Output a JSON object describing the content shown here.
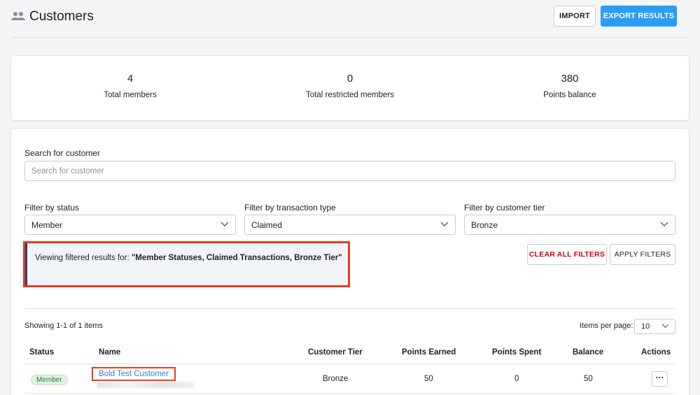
{
  "header": {
    "title": "Customers",
    "icon": "people-icon",
    "import_label": "IMPORT",
    "export_label": "EXPORT RESULTS",
    "accent": "#2d9cf4"
  },
  "stats": [
    {
      "value": "4",
      "label": "Total members"
    },
    {
      "value": "0",
      "label": "Total restricted members"
    },
    {
      "value": "380",
      "label": "Points balance"
    }
  ],
  "search": {
    "label": "Search for customer",
    "placeholder": "Search for customer",
    "value": ""
  },
  "filters": {
    "status": {
      "label": "Filter by status",
      "selected": "Member"
    },
    "transaction": {
      "label": "Filter by transaction type",
      "selected": "Claimed"
    },
    "tier": {
      "label": "Filter by customer tier",
      "selected": "Bronze"
    },
    "clear_label": "CLEAR ALL FILTERS",
    "apply_label": "APPLY FILTERS"
  },
  "banner": {
    "prefix": "Viewing filtered results for: ",
    "value": "\"Member Statuses, Claimed Transactions, Bronze Tier\""
  },
  "results": {
    "showing": "Showing 1-1 of 1 items",
    "items_per_page_label": "Items per page:",
    "items_per_page": "10"
  },
  "table": {
    "columns": [
      "Status",
      "Name",
      "Customer Tier",
      "Points Earned",
      "Points Spent",
      "Balance",
      "Actions"
    ],
    "rows": [
      {
        "status": "Member",
        "name": "Bold Test Customer",
        "tier": "Bronze",
        "earned": "50",
        "spent": "0",
        "balance": "50",
        "actions": "···"
      }
    ]
  },
  "colors": {
    "highlight": "#ec3a1f",
    "link": "#2d7fd4",
    "badge_bg": "#e3f1df",
    "danger": "#bf0711"
  }
}
